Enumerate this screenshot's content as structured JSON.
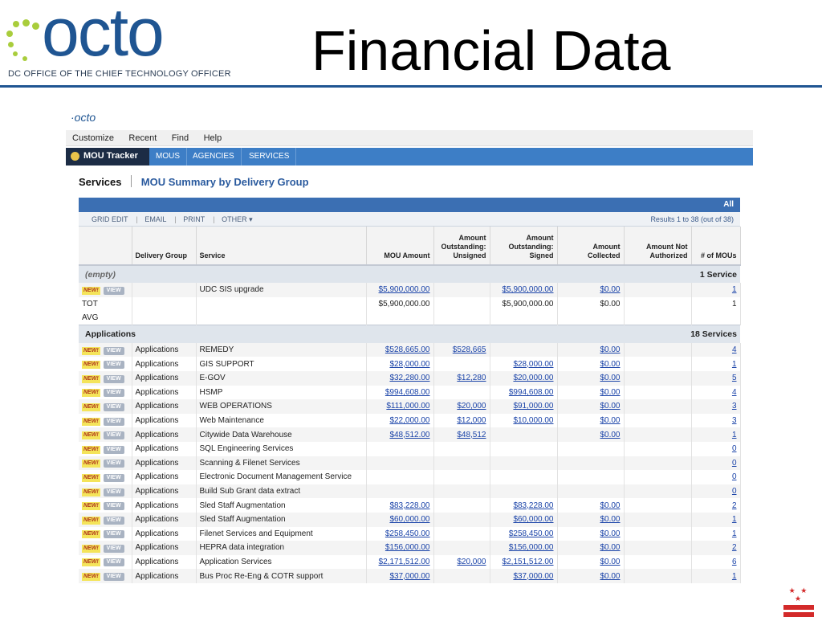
{
  "slide": {
    "logo_text": "octo",
    "logo_subtitle": "DC OFFICE OF THE CHIEF TECHNOLOGY OFFICER",
    "title": "Financial Data"
  },
  "app": {
    "mini_logo": "·octo",
    "menu": [
      "Customize",
      "Recent",
      "Find",
      "Help"
    ],
    "nav": {
      "home": "MOU Tracker",
      "tabs": [
        "MOUS",
        "AGENCIES",
        "SERVICES"
      ]
    },
    "breadcrumb": "Services",
    "page_title": "MOU Summary by Delivery Group",
    "all_label": "All",
    "toolbar": {
      "actions": [
        "GRID EDIT",
        "EMAIL",
        "PRINT",
        "OTHER ▾"
      ],
      "results": "Results 1 to 38 (out of 38)"
    },
    "columns": [
      "",
      "Delivery Group",
      "Service",
      "MOU Amount",
      "Amount Outstanding: Unsigned",
      "Amount Outstanding: Signed",
      "Amount Collected",
      "Amount Not Authorized",
      "# of MOUs"
    ],
    "badges": {
      "new": "NEW!",
      "view": "VIEW"
    },
    "groups": [
      {
        "name": "(empty)",
        "count_label": "1 Service",
        "rows": [
          {
            "group": "",
            "service": "UDC SIS upgrade",
            "mou": "$5,900,000.00",
            "unsigned": "",
            "signed": "$5,900,000.00",
            "collected": "$0.00",
            "not_auth": "",
            "count": "1"
          }
        ],
        "totals": [
          {
            "label": "TOT",
            "mou": "$5,900,000.00",
            "signed": "$5,900,000.00",
            "collected": "$0.00",
            "count": "1"
          },
          {
            "label": "AVG",
            "mou": "",
            "signed": "",
            "collected": "",
            "count": ""
          }
        ]
      },
      {
        "name": "Applications",
        "count_label": "18 Services",
        "rows": [
          {
            "group": "Applications",
            "service": "REMEDY",
            "mou": "$528,665.00",
            "unsigned": "$528,665",
            "signed": "",
            "collected": "$0.00",
            "not_auth": "",
            "count": "4"
          },
          {
            "group": "Applications",
            "service": "GIS SUPPORT",
            "mou": "$28,000.00",
            "unsigned": "",
            "signed": "$28,000.00",
            "collected": "$0.00",
            "not_auth": "",
            "count": "1"
          },
          {
            "group": "Applications",
            "service": "E-GOV",
            "mou": "$32,280.00",
            "unsigned": "$12,280",
            "signed": "$20,000.00",
            "collected": "$0.00",
            "not_auth": "",
            "count": "5"
          },
          {
            "group": "Applications",
            "service": "HSMP",
            "mou": "$994,608.00",
            "unsigned": "",
            "signed": "$994,608.00",
            "collected": "$0.00",
            "not_auth": "",
            "count": "4"
          },
          {
            "group": "Applications",
            "service": "WEB OPERATIONS",
            "mou": "$111,000.00",
            "unsigned": "$20,000",
            "signed": "$91,000.00",
            "collected": "$0.00",
            "not_auth": "",
            "count": "3"
          },
          {
            "group": "Applications",
            "service": "Web Maintenance",
            "mou": "$22,000.00",
            "unsigned": "$12,000",
            "signed": "$10,000.00",
            "collected": "$0.00",
            "not_auth": "",
            "count": "3"
          },
          {
            "group": "Applications",
            "service": "Citywide Data Warehouse",
            "mou": "$48,512.00",
            "unsigned": "$48,512",
            "signed": "",
            "collected": "$0.00",
            "not_auth": "",
            "count": "1"
          },
          {
            "group": "Applications",
            "service": "SQL Engineering Services",
            "mou": "",
            "unsigned": "",
            "signed": "",
            "collected": "",
            "not_auth": "",
            "count": "0"
          },
          {
            "group": "Applications",
            "service": "Scanning & Filenet Services",
            "mou": "",
            "unsigned": "",
            "signed": "",
            "collected": "",
            "not_auth": "",
            "count": "0"
          },
          {
            "group": "Applications",
            "service": "Electronic Document Management Service",
            "mou": "",
            "unsigned": "",
            "signed": "",
            "collected": "",
            "not_auth": "",
            "count": "0"
          },
          {
            "group": "Applications",
            "service": "Build Sub Grant data extract",
            "mou": "",
            "unsigned": "",
            "signed": "",
            "collected": "",
            "not_auth": "",
            "count": "0"
          },
          {
            "group": "Applications",
            "service": "Sled Staff Augmentation",
            "mou": "$83,228.00",
            "unsigned": "",
            "signed": "$83,228.00",
            "collected": "$0.00",
            "not_auth": "",
            "count": "2"
          },
          {
            "group": "Applications",
            "service": "Sled Staff Augmentation",
            "mou": "$60,000.00",
            "unsigned": "",
            "signed": "$60,000.00",
            "collected": "$0.00",
            "not_auth": "",
            "count": "1"
          },
          {
            "group": "Applications",
            "service": "Filenet Services and Equipment",
            "mou": "$258,450.00",
            "unsigned": "",
            "signed": "$258,450.00",
            "collected": "$0.00",
            "not_auth": "",
            "count": "1"
          },
          {
            "group": "Applications",
            "service": "HEPRA data integration",
            "mou": "$156,000.00",
            "unsigned": "",
            "signed": "$156,000.00",
            "collected": "$0.00",
            "not_auth": "",
            "count": "2"
          },
          {
            "group": "Applications",
            "service": "Application Services",
            "mou": "$2,171,512.00",
            "unsigned": "$20,000",
            "signed": "$2,151,512.00",
            "collected": "$0.00",
            "not_auth": "",
            "count": "6"
          },
          {
            "group": "Applications",
            "service": "Bus Proc Re-Eng & COTR support",
            "mou": "$37,000.00",
            "unsigned": "",
            "signed": "$37,000.00",
            "collected": "$0.00",
            "not_auth": "",
            "count": "1"
          }
        ]
      }
    ]
  },
  "flag": {
    "stars": "★ ★ ★"
  }
}
